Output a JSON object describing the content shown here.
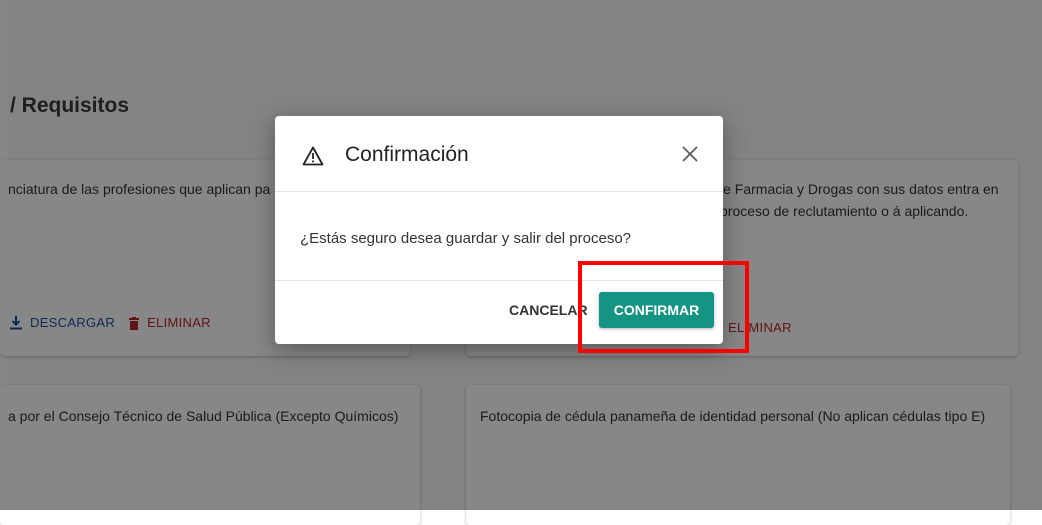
{
  "page": {
    "title": "/ Requisitos"
  },
  "cards": [
    {
      "text": "nciatura de las profesiones que aplican pa",
      "actions": {
        "download_label": "DESCARGAR",
        "delete_label": "ELIMINAR"
      }
    },
    {
      "text": "le Farmacia y Drogas con sus datos entra en proceso de reclutamiento o á aplicando.",
      "actions": {
        "delete_label": "ELIMINAR"
      }
    },
    {
      "text": "a por el Consejo Técnico de Salud Pública (Excepto Químicos)"
    },
    {
      "text": "Fotocopia de cédula panameña de identidad personal (No aplican cédulas tipo E)"
    }
  ],
  "dialog": {
    "icon": "warning-icon",
    "title": "Confirmación",
    "message": "¿Estás seguro desea guardar y salir del proceso?",
    "cancel_label": "CANCELAR",
    "confirm_label": "CONFIRMAR"
  },
  "colors": {
    "confirm_button": "#159483",
    "download_link": "#1f4e9a",
    "delete_link": "#b7242a",
    "highlight": "#ff0000"
  }
}
